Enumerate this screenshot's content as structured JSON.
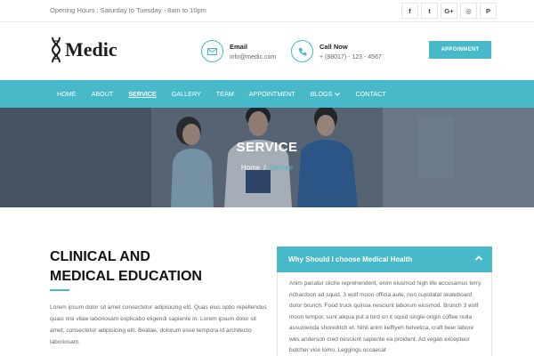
{
  "topbar": {
    "hours": "Opening Hours : Saturday to Tuesday - 8am to 10pm",
    "social": [
      {
        "icon": "facebook-icon",
        "glyph": "f"
      },
      {
        "icon": "twitter-icon",
        "glyph": "t"
      },
      {
        "icon": "google-plus-icon",
        "glyph": "G+"
      },
      {
        "icon": "instagram-icon",
        "glyph": "◎"
      },
      {
        "icon": "pinterest-icon",
        "glyph": "P"
      }
    ]
  },
  "header": {
    "logo_text": "Medic",
    "email": {
      "title": "Email",
      "value": "info@medic.com",
      "icon": "mail-icon"
    },
    "call": {
      "title": "Call Now",
      "value": "+ (88017) - 123 - 4567",
      "icon": "phone-icon"
    },
    "appointment_button": "APPOINMENT"
  },
  "nav": {
    "items": [
      "HOME",
      "ABOUT",
      "SERVICE",
      "GALLERY",
      "TEAM",
      "APPOINTMENT",
      "BLOGS",
      "CONTACT"
    ],
    "active": "SERVICE"
  },
  "hero": {
    "title": "SERVICE",
    "breadcrumb": {
      "home": "Home",
      "separator": "/",
      "current": "Service"
    }
  },
  "content": {
    "title_line1": "CLINICAL AND",
    "title_line2": "MEDICAL EDUCATION",
    "body": "Lorem ipsum dolor sit amet consectetur adipisicing elit. Quas eius optio repellendus quasi nisi vitae laboriosam explicabo eligendi sapiente in. Lorem ipsum dolor sit amet, consectetur adipisicing elit. Beatae, dolorum esse tempora id architecto laboriosam."
  },
  "accordion": {
    "heading": "Why Should I choose Medical Health",
    "body": "Anim pariatur cliche reprehenderit, enim eiusmod high life accusamus terry richardson ad squid. 3 wolf moon officia aute, non cupidatat skateboard dolor brunch. Food truck quinoa nesciunt laborum eiusmod. Brunch 3 wolf moon tempor, sunt aliqua put a bird on it squid single-origin coffee nulla assumenda shoreditch et. Nihil anim keffiyeh helvetica, craft beer labore wes anderson cred nesciunt sapiente ea proident. Ad vegan excepteur butcher vice lomo. Leggings occaecat"
  },
  "colors": {
    "accent": "#47b9c8",
    "text": "#333333"
  }
}
